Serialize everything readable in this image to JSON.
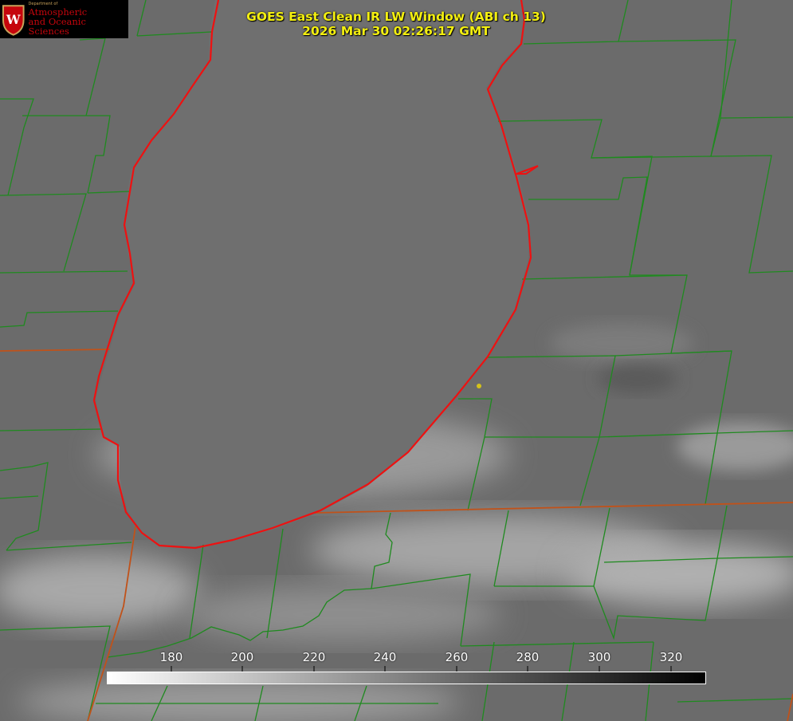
{
  "logo": {
    "department": "Department of",
    "line1": "Atmospheric",
    "line2": "and Oceanic Sciences",
    "seal_letter": "W"
  },
  "header": {
    "title": "GOES East Clean IR LW Window (ABI ch 13)",
    "timestamp": "2026 Mar 30 02:26:17 GMT"
  },
  "colorbar": {
    "ticks": [
      "180",
      "200",
      "220",
      "240",
      "260",
      "280",
      "300",
      "320"
    ],
    "gradient_from": "#ffffff",
    "gradient_to": "#000000"
  },
  "colors": {
    "title_text": "#f3ef10",
    "county_lines": "#1f8a1f",
    "state_lines": "#c0521a",
    "coastline": "#ee1111",
    "background": "#6a6a6a",
    "station_marker": "#d4c21a"
  }
}
